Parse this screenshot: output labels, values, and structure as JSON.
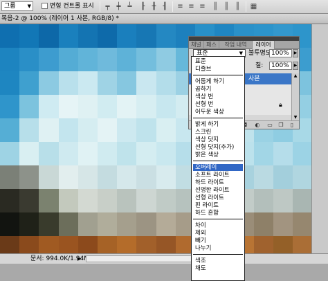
{
  "toolbar": {
    "mode_value": "그룹",
    "transform_controls_label": "변형 컨트롤 표시",
    "transform_controls_checked": false,
    "icon_names": [
      "align-top-icon",
      "align-vcenter-icon",
      "align-bottom-icon",
      "align-left-icon",
      "align-hcenter-icon",
      "align-right-icon",
      "distribute-top-icon",
      "distribute-vcenter-icon",
      "distribute-bottom-icon",
      "distribute-left-icon",
      "distribute-hcenter-icon",
      "distribute-right-icon"
    ]
  },
  "document": {
    "title": "복음-2 @ 100% (레이어 1 사본, RGB/8) *"
  },
  "status": {
    "doc_info": "문서: 994.0K/1.94M",
    "arrow": "▶"
  },
  "layers_panel": {
    "tabs": [
      "채널",
      "패스",
      "작업 내역",
      "레이어"
    ],
    "active_tab": "레이어",
    "blend_mode": "표준",
    "opacity_label": "불투명도:",
    "opacity_value": "100%",
    "fill_label": "칠:",
    "fill_value": "100%",
    "selected_layer_partial": "사본",
    "footer_icons": [
      "link-icon",
      "fx-icon",
      "mask-icon",
      "adjustment-icon",
      "folder-icon",
      "new-layer-icon",
      "trash-icon"
    ]
  },
  "blend_dropdown": {
    "groups": [
      [
        "표준",
        "디졸브"
      ],
      [
        "어둡게 하기",
        "곱하기",
        "색상 번",
        "선형 번",
        "어두운 색상"
      ],
      [
        "밝게 하기",
        "스크린",
        "색상 닷지",
        "선형 닷지(추가)",
        "밝은 색상"
      ],
      [
        "오버레이",
        "소프트 라이트",
        "하드 라이트",
        "선명한 라이트",
        "선형 라이트",
        "핀 라이트",
        "하드 혼합"
      ],
      [
        "차이",
        "제외",
        "빼기",
        "나누기"
      ],
      [
        "색조",
        "채도"
      ]
    ],
    "selected": "오버레이"
  },
  "colors": {
    "selection": "#3167c5",
    "layer_selected": "#3a76c7",
    "canvas_blue": "#1a7ab8"
  }
}
